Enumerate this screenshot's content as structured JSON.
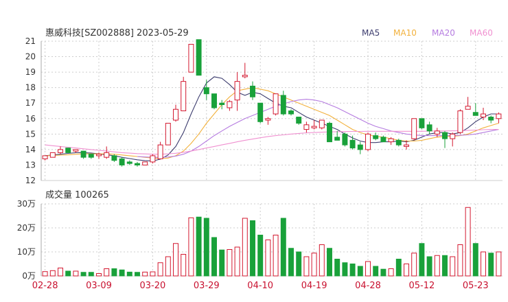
{
  "title": "惠威科技[SZ002888] 2023-05-29",
  "legend": [
    {
      "label": "MA5",
      "color": "#3c3c6e"
    },
    {
      "label": "MA10",
      "color": "#f2b13c"
    },
    {
      "label": "MA20",
      "color": "#b57be0"
    },
    {
      "label": "MA60",
      "color": "#f090d0"
    }
  ],
  "colors": {
    "up": "#d3172e",
    "down": "#19a13a",
    "grid": "#cccccc",
    "date_label": "#c8102e"
  },
  "volume_label": "成交量 100265",
  "chart_data": [
    {
      "type": "candlestick",
      "title": "惠威科技[SZ002888] 2023-05-29",
      "ylim": [
        12,
        21
      ],
      "yticks": [
        "12",
        "13",
        "14",
        "15",
        "16",
        "17",
        "18",
        "19",
        "20",
        "21"
      ],
      "xticks": [
        "02-28",
        "03-09",
        "03-20",
        "03-29",
        "04-10",
        "04-19",
        "04-28",
        "05-12",
        "05-23"
      ],
      "xtick_index": [
        0,
        7,
        14,
        21,
        28,
        35,
        42,
        49,
        56
      ],
      "candles": [
        {
          "o": 13.4,
          "h": 13.6,
          "l": 13.3,
          "c": 13.6
        },
        {
          "o": 13.5,
          "h": 13.8,
          "l": 13.5,
          "c": 13.8
        },
        {
          "o": 13.8,
          "h": 14.2,
          "l": 13.7,
          "c": 14.0
        },
        {
          "o": 14.1,
          "h": 14.1,
          "l": 13.8,
          "c": 13.8
        },
        {
          "o": 13.9,
          "h": 14.0,
          "l": 13.8,
          "c": 14.0
        },
        {
          "o": 13.9,
          "h": 13.9,
          "l": 13.4,
          "c": 13.5
        },
        {
          "o": 13.7,
          "h": 13.7,
          "l": 13.4,
          "c": 13.5
        },
        {
          "o": 13.6,
          "h": 13.8,
          "l": 13.4,
          "c": 13.7
        },
        {
          "o": 13.5,
          "h": 14.2,
          "l": 13.4,
          "c": 13.8
        },
        {
          "o": 13.6,
          "h": 13.7,
          "l": 13.2,
          "c": 13.3
        },
        {
          "o": 13.4,
          "h": 13.5,
          "l": 12.9,
          "c": 13.0
        },
        {
          "o": 13.2,
          "h": 13.3,
          "l": 13.0,
          "c": 13.1
        },
        {
          "o": 13.1,
          "h": 13.2,
          "l": 12.9,
          "c": 13.0
        },
        {
          "o": 13.0,
          "h": 13.2,
          "l": 13.0,
          "c": 13.2
        },
        {
          "o": 13.2,
          "h": 13.7,
          "l": 13.1,
          "c": 13.6
        },
        {
          "o": 13.4,
          "h": 14.5,
          "l": 13.4,
          "c": 14.3
        },
        {
          "o": 14.3,
          "h": 15.7,
          "l": 14.3,
          "c": 15.7
        },
        {
          "o": 15.9,
          "h": 16.9,
          "l": 15.8,
          "c": 16.6
        },
        {
          "o": 16.5,
          "h": 18.7,
          "l": 16.5,
          "c": 18.4
        },
        {
          "o": 19.0,
          "h": 20.8,
          "l": 19.0,
          "c": 20.8
        },
        {
          "o": 21.1,
          "h": 21.1,
          "l": 18.8,
          "c": 18.8
        },
        {
          "o": 18.0,
          "h": 18.5,
          "l": 17.2,
          "c": 17.6
        },
        {
          "o": 17.6,
          "h": 17.6,
          "l": 16.6,
          "c": 16.7
        },
        {
          "o": 17.0,
          "h": 17.2,
          "l": 16.6,
          "c": 16.9
        },
        {
          "o": 16.7,
          "h": 17.2,
          "l": 16.5,
          "c": 17.1
        },
        {
          "o": 17.2,
          "h": 19.0,
          "l": 16.5,
          "c": 18.4
        },
        {
          "o": 18.7,
          "h": 19.6,
          "l": 18.6,
          "c": 18.8
        },
        {
          "o": 18.1,
          "h": 18.4,
          "l": 17.2,
          "c": 17.4
        },
        {
          "o": 17.0,
          "h": 17.0,
          "l": 15.7,
          "c": 15.8
        },
        {
          "o": 15.9,
          "h": 16.1,
          "l": 15.6,
          "c": 16.0
        },
        {
          "o": 16.3,
          "h": 17.6,
          "l": 16.2,
          "c": 17.6
        },
        {
          "o": 17.5,
          "h": 17.8,
          "l": 16.2,
          "c": 16.3
        },
        {
          "o": 16.5,
          "h": 16.6,
          "l": 16.2,
          "c": 16.3
        },
        {
          "o": 16.1,
          "h": 16.1,
          "l": 15.6,
          "c": 15.7
        },
        {
          "o": 15.3,
          "h": 15.8,
          "l": 15.1,
          "c": 15.6
        },
        {
          "o": 15.4,
          "h": 15.9,
          "l": 15.3,
          "c": 15.5
        },
        {
          "o": 15.4,
          "h": 15.9,
          "l": 15.3,
          "c": 15.9
        },
        {
          "o": 15.7,
          "h": 15.8,
          "l": 14.5,
          "c": 14.5
        },
        {
          "o": 14.8,
          "h": 15.2,
          "l": 14.6,
          "c": 14.6
        },
        {
          "o": 15.0,
          "h": 15.1,
          "l": 14.2,
          "c": 14.3
        },
        {
          "o": 14.6,
          "h": 14.9,
          "l": 14.0,
          "c": 14.1
        },
        {
          "o": 14.3,
          "h": 14.5,
          "l": 13.7,
          "c": 14.0
        },
        {
          "o": 14.0,
          "h": 15.1,
          "l": 13.9,
          "c": 15.0
        },
        {
          "o": 14.9,
          "h": 15.1,
          "l": 14.6,
          "c": 14.7
        },
        {
          "o": 14.8,
          "h": 14.9,
          "l": 14.5,
          "c": 14.5
        },
        {
          "o": 14.5,
          "h": 14.8,
          "l": 14.3,
          "c": 14.7
        },
        {
          "o": 14.6,
          "h": 14.7,
          "l": 14.2,
          "c": 14.3
        },
        {
          "o": 14.2,
          "h": 14.6,
          "l": 14.0,
          "c": 14.3
        },
        {
          "o": 14.7,
          "h": 16.0,
          "l": 14.6,
          "c": 16.0
        },
        {
          "o": 16.0,
          "h": 16.0,
          "l": 15.3,
          "c": 15.4
        },
        {
          "o": 15.6,
          "h": 15.8,
          "l": 15.0,
          "c": 15.2
        },
        {
          "o": 15.0,
          "h": 15.4,
          "l": 14.8,
          "c": 15.2
        },
        {
          "o": 15.1,
          "h": 15.2,
          "l": 14.1,
          "c": 14.7
        },
        {
          "o": 14.7,
          "h": 15.1,
          "l": 14.2,
          "c": 15.0
        },
        {
          "o": 15.1,
          "h": 16.6,
          "l": 15.0,
          "c": 16.5
        },
        {
          "o": 16.6,
          "h": 17.4,
          "l": 16.6,
          "c": 16.8
        },
        {
          "o": 16.4,
          "h": 17.0,
          "l": 16.2,
          "c": 16.2
        },
        {
          "o": 16.1,
          "h": 16.7,
          "l": 15.9,
          "c": 16.3
        },
        {
          "o": 16.1,
          "h": 16.2,
          "l": 15.7,
          "c": 15.9
        },
        {
          "o": 16.0,
          "h": 16.4,
          "l": 15.7,
          "c": 16.3
        }
      ],
      "ma_series": [
        {
          "name": "MA5",
          "color": "#3c3c6e",
          "values": [
            13.6,
            13.65,
            13.7,
            13.75,
            13.8,
            13.8,
            13.78,
            13.72,
            13.66,
            13.6,
            13.5,
            13.42,
            13.34,
            13.28,
            13.26,
            13.38,
            13.65,
            14.2,
            15.1,
            16.3,
            17.4,
            18.3,
            18.7,
            18.6,
            18.2,
            17.7,
            17.5,
            17.7,
            17.6,
            17.3,
            17.0,
            16.8,
            16.7,
            16.4,
            16.1,
            15.9,
            15.7,
            15.5,
            15.3,
            15.0,
            14.75,
            14.55,
            14.45,
            14.45,
            14.5,
            14.5,
            14.55,
            14.5,
            14.6,
            14.8,
            15.0,
            15.1,
            15.1,
            15.0,
            15.1,
            15.4,
            15.8,
            16.1,
            16.3,
            16.3
          ]
        },
        {
          "name": "MA10",
          "color": "#f2b13c",
          "values": [
            13.6,
            13.62,
            13.64,
            13.66,
            13.7,
            13.72,
            13.72,
            13.72,
            13.72,
            13.7,
            13.65,
            13.6,
            13.55,
            13.5,
            13.45,
            13.42,
            13.45,
            13.6,
            13.9,
            14.4,
            15.0,
            15.7,
            16.3,
            16.9,
            17.4,
            17.8,
            17.9,
            18.0,
            17.9,
            17.8,
            17.6,
            17.4,
            17.2,
            17.0,
            16.8,
            16.6,
            16.4,
            16.2,
            15.9,
            15.6,
            15.3,
            15.1,
            14.95,
            14.85,
            14.8,
            14.7,
            14.6,
            14.55,
            14.55,
            14.6,
            14.7,
            14.8,
            14.85,
            14.85,
            14.9,
            15.0,
            15.2,
            15.4,
            15.55,
            15.7
          ]
        },
        {
          "name": "MA20",
          "color": "#b57be0",
          "values": [
            null,
            null,
            null,
            null,
            null,
            null,
            null,
            null,
            null,
            null,
            null,
            null,
            13.55,
            13.52,
            13.5,
            13.5,
            13.52,
            13.58,
            13.7,
            13.9,
            14.2,
            14.55,
            14.9,
            15.2,
            15.5,
            15.75,
            16.0,
            16.2,
            16.4,
            16.6,
            16.8,
            16.95,
            17.1,
            17.2,
            17.25,
            17.2,
            17.1,
            16.9,
            16.7,
            16.45,
            16.2,
            15.95,
            15.7,
            15.5,
            15.35,
            15.2,
            15.1,
            15.0,
            14.95,
            14.9,
            14.9,
            14.9,
            14.9,
            14.9,
            14.92,
            14.95,
            15.0,
            15.1,
            15.2,
            15.3
          ]
        },
        {
          "name": "MA60",
          "color": "#f090d0",
          "values": [
            14.3,
            14.25,
            14.2,
            14.15,
            14.1,
            14.05,
            14.0,
            13.95,
            13.9,
            13.85,
            13.8,
            13.77,
            13.74,
            13.72,
            13.7,
            13.7,
            13.72,
            13.76,
            13.82,
            13.9,
            14.0,
            14.1,
            14.2,
            14.3,
            14.4,
            14.5,
            14.6,
            14.68,
            14.76,
            14.84,
            14.9,
            14.95,
            15.0,
            15.04,
            15.08,
            15.1,
            15.12,
            15.14,
            15.15,
            15.16,
            15.17,
            15.17,
            15.18,
            15.18,
            15.18,
            15.18,
            15.18,
            15.18,
            15.18,
            15.18,
            15.19,
            15.2,
            15.2,
            15.21,
            15.22,
            15.24,
            15.26,
            15.28,
            15.3,
            15.3
          ]
        }
      ]
    },
    {
      "type": "bar",
      "title": "成交量 100265",
      "ylim": [
        0,
        300000
      ],
      "yticks": [
        "0万",
        "10万",
        "20万",
        "30万"
      ],
      "values": [
        18000,
        22000,
        33000,
        20000,
        20000,
        15000,
        15000,
        10000,
        30000,
        30000,
        25000,
        16000,
        15000,
        16000,
        17000,
        55000,
        80000,
        135000,
        90000,
        242000,
        245000,
        240000,
        160000,
        108000,
        110000,
        120000,
        240000,
        230000,
        170000,
        150000,
        170000,
        240000,
        115000,
        100000,
        80000,
        95000,
        130000,
        115000,
        70000,
        55000,
        50000,
        40000,
        60000,
        40000,
        28000,
        30000,
        70000,
        50000,
        95000,
        135000,
        80000,
        85000,
        85000,
        80000,
        130000,
        285000,
        135000,
        100000,
        95000,
        100000
      ]
    }
  ]
}
